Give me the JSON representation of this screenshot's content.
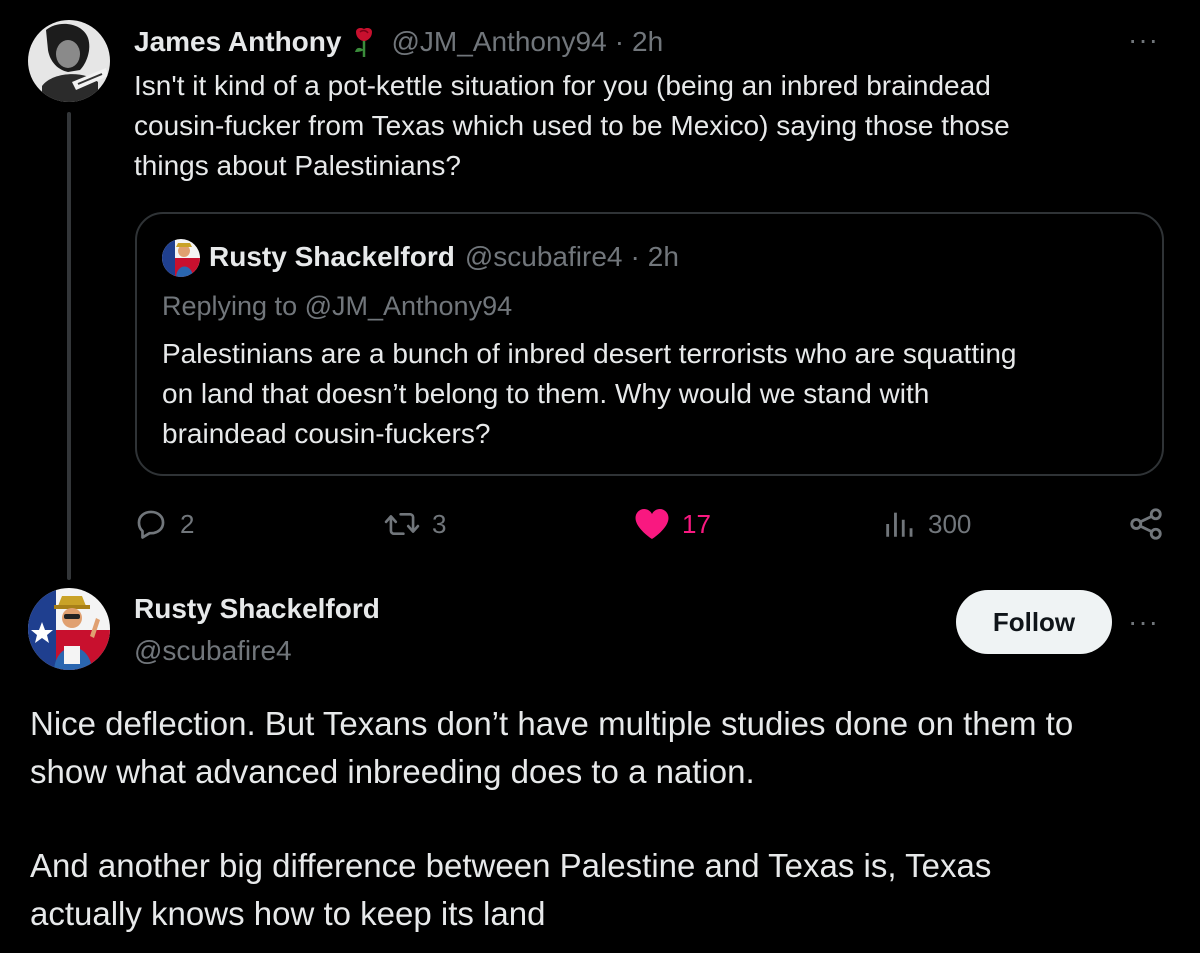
{
  "tweet": {
    "author_name": "James Anthony",
    "author_handle": "@JM_Anthony94",
    "separator": "·",
    "time": "2h",
    "text_lines": [
      "Isn't it kind of a pot-kettle situation for you (being an inbred braindead",
      "cousin-fucker from Texas which used to be Mexico) saying those those",
      "things about Palestinians?"
    ],
    "more_label": "···",
    "quote": {
      "author_name": "Rusty Shackelford",
      "author_handle": "@scubafire4",
      "separator": "·",
      "time": "2h",
      "replying_to": "Replying to @JM_Anthony94",
      "text_lines": [
        "Palestinians are a bunch of inbred desert terrorists who are squatting",
        "on land that doesn’t belong to them. Why would we stand with",
        "braindead cousin-fuckers?"
      ]
    },
    "actions": {
      "replies": "2",
      "reposts": "3",
      "likes": "17",
      "views": "300"
    }
  },
  "reply": {
    "author_name": "Rusty Shackelford",
    "author_handle": "@scubafire4",
    "follow_label": "Follow",
    "more_label": "···",
    "paragraph1_lines": [
      "Nice deflection. But Texans don’t have multiple studies done on them to",
      "show what advanced inbreeding does to a nation."
    ],
    "paragraph2_lines": [
      "And another big difference between Palestine and Texas is, Texas",
      "actually knows how to keep its land"
    ]
  },
  "colors": {
    "background": "#000000",
    "text_primary": "#e7e9ea",
    "text_secondary": "#71767b",
    "like_active": "#f91880",
    "border": "#2f3336",
    "follow_button_bg": "#eff3f4"
  },
  "icons": {
    "reply": "speech-bubble-icon",
    "repost": "repost-arrows-icon",
    "like": "heart-icon",
    "views": "bar-chart-icon",
    "share": "share-nodes-icon",
    "rose": "rose-emoji-icon"
  }
}
